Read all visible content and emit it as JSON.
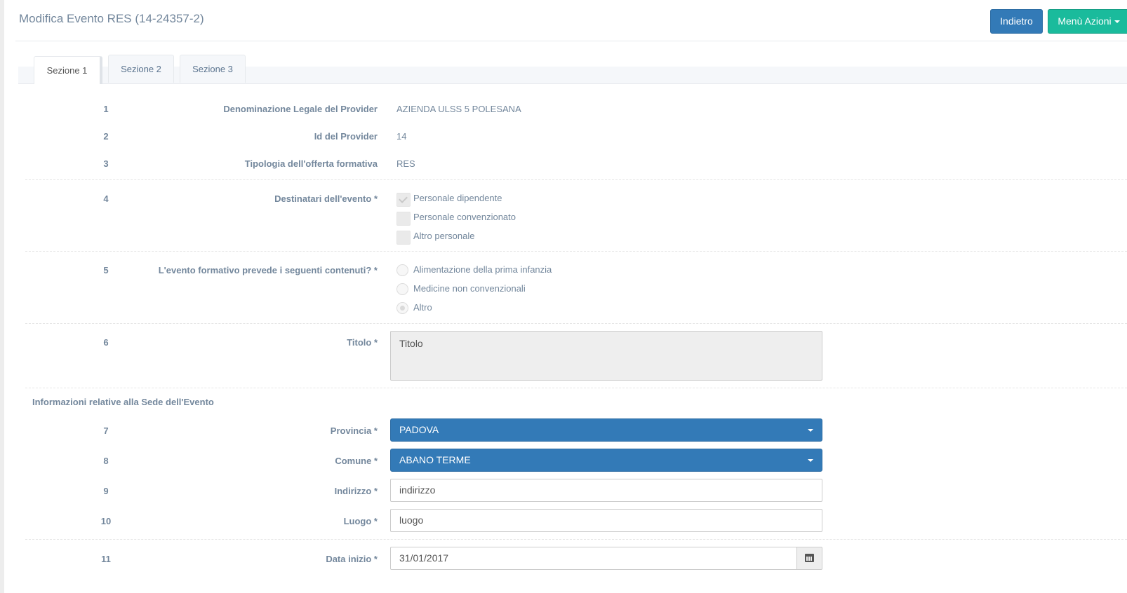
{
  "header": {
    "title": "Modifica Evento RES (14-24357-2)",
    "back_label": "Indietro",
    "actions_label": "Menù Azioni"
  },
  "tabs": [
    {
      "label": "Sezione 1",
      "active": true
    },
    {
      "label": "Sezione 2",
      "active": false
    },
    {
      "label": "Sezione 3",
      "active": false
    }
  ],
  "rows": {
    "r1": {
      "num": "1",
      "label": "Denominazione Legale del Provider",
      "value": "AZIENDA ULSS 5 POLESANA"
    },
    "r2": {
      "num": "2",
      "label": "Id del Provider",
      "value": "14"
    },
    "r3": {
      "num": "3",
      "label": "Tipologia dell'offerta formativa",
      "value": "RES"
    },
    "r4": {
      "num": "4",
      "label": "Destinatari dell'evento *",
      "options": [
        {
          "label": "Personale dipendente",
          "checked": true
        },
        {
          "label": "Personale convenzionato",
          "checked": false
        },
        {
          "label": "Altro personale",
          "checked": false
        }
      ]
    },
    "r5": {
      "num": "5",
      "label": "L'evento formativo prevede i seguenti contenuti? *",
      "options": [
        {
          "label": "Alimentazione della prima infanzia",
          "checked": false
        },
        {
          "label": "Medicine non convenzionali",
          "checked": false
        },
        {
          "label": "Altro",
          "checked": true
        }
      ]
    },
    "r6": {
      "num": "6",
      "label": "Titolo *",
      "value": "Titolo"
    },
    "section_sede": "Informazioni relative alla Sede dell'Evento",
    "r7": {
      "num": "7",
      "label": "Provincia *",
      "value": "PADOVA"
    },
    "r8": {
      "num": "8",
      "label": "Comune *",
      "value": "ABANO TERME"
    },
    "r9": {
      "num": "9",
      "label": "Indirizzo *",
      "value": "indirizzo"
    },
    "r10": {
      "num": "10",
      "label": "Luogo *",
      "value": "luogo"
    },
    "r11": {
      "num": "11",
      "label": "Data inizio *",
      "value": "31/01/2017"
    }
  },
  "colors": {
    "primary": "#337ab7",
    "success": "#1abb9c",
    "text": "#73879c"
  },
  "icons": {
    "calendar": "calendar-icon"
  }
}
